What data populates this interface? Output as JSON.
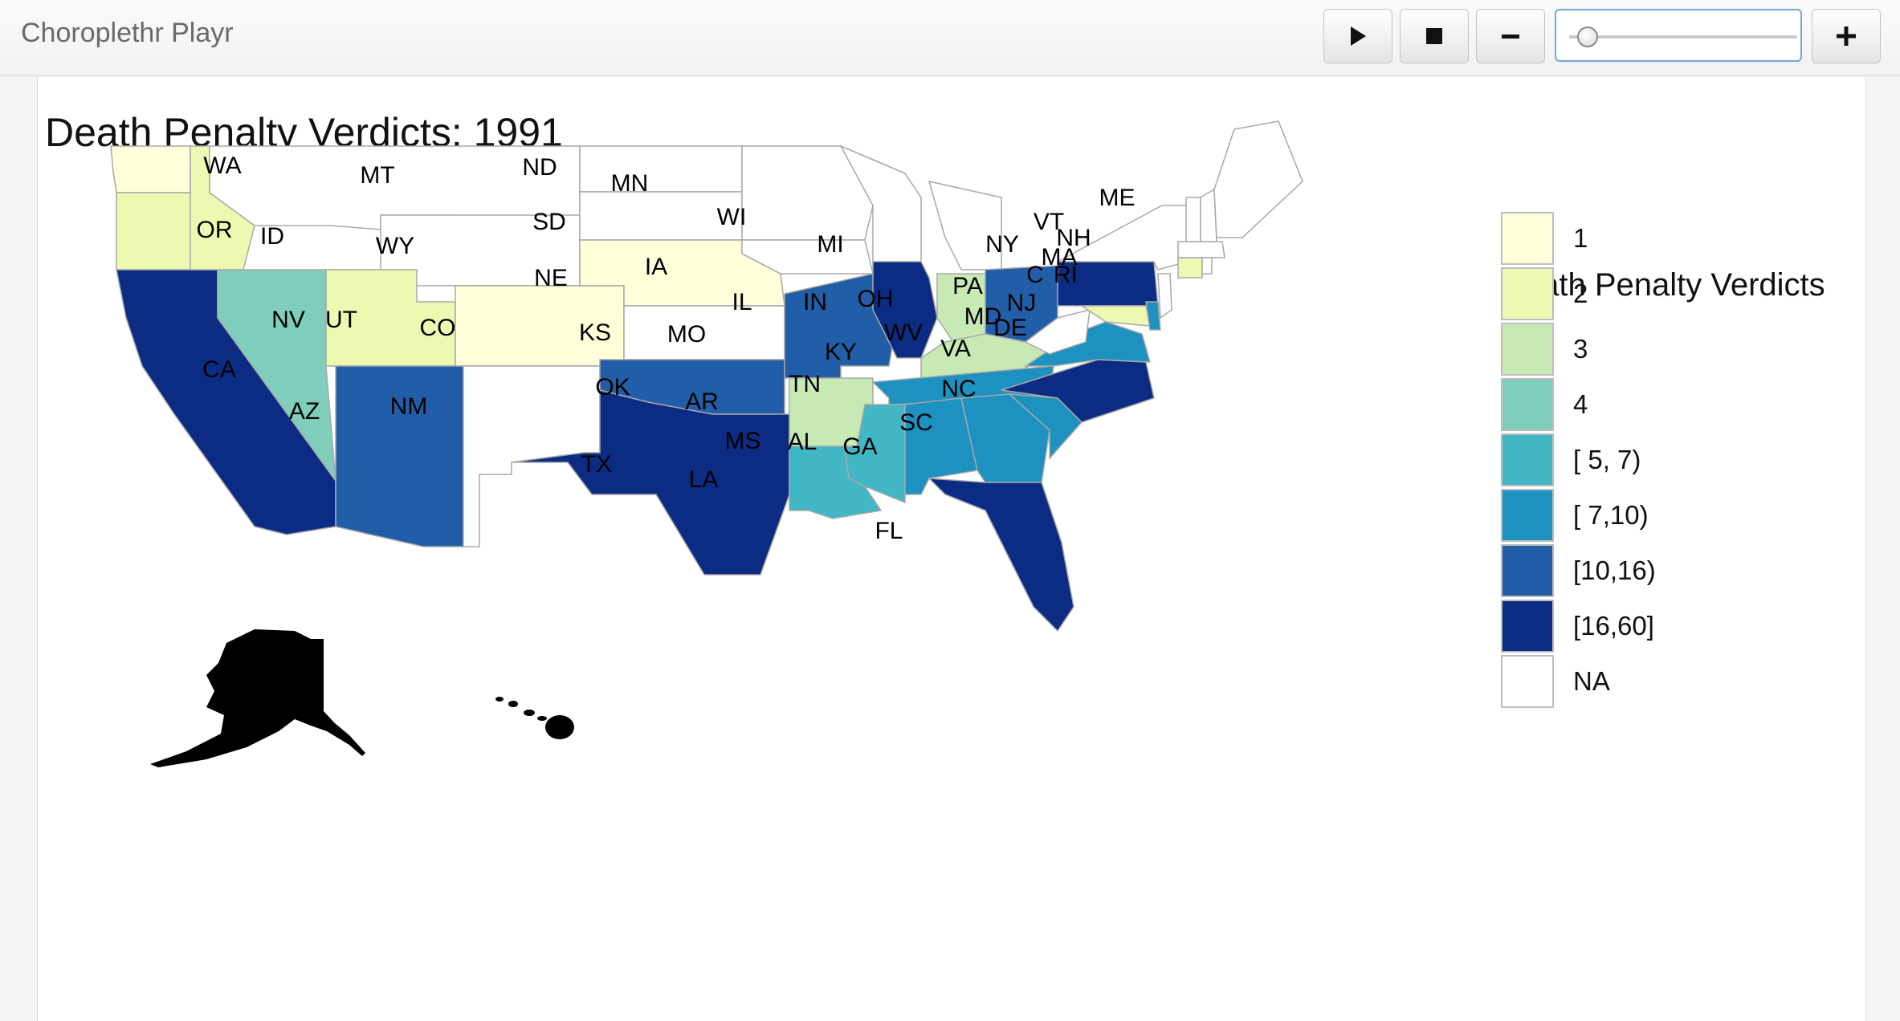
{
  "app": {
    "title": "Choroplethr Playr"
  },
  "controls": {
    "play_icon": "play-icon",
    "stop_icon": "stop-icon",
    "minus_icon": "minus-icon",
    "plus_icon": "plus-icon",
    "slider_value_fraction": 0.08
  },
  "map": {
    "title": "Death Penalty Verdicts: 1991",
    "legend": {
      "title": "Death Penalty Verdicts",
      "items": [
        {
          "label": "1",
          "color": "#ffffd9"
        },
        {
          "label": "2",
          "color": "#edf8b1"
        },
        {
          "label": "3",
          "color": "#c7e9b4"
        },
        {
          "label": "4",
          "color": "#7fcdbb"
        },
        {
          "label": "[ 5, 7)",
          "color": "#41b6c4"
        },
        {
          "label": "[ 7,10)",
          "color": "#1d91c0"
        },
        {
          "label": "[10,16)",
          "color": "#225ea8"
        },
        {
          "label": "[16,60]",
          "color": "#0c2c84"
        },
        {
          "label": "NA",
          "color": "#ffffff"
        }
      ]
    },
    "states": [
      {
        "abbr": "WA",
        "bin": "1"
      },
      {
        "abbr": "OR",
        "bin": "2"
      },
      {
        "abbr": "CA",
        "bin": "[16,60]"
      },
      {
        "abbr": "ID",
        "bin": "2"
      },
      {
        "abbr": "NV",
        "bin": "4"
      },
      {
        "abbr": "MT",
        "bin": "NA"
      },
      {
        "abbr": "WY",
        "bin": "NA"
      },
      {
        "abbr": "UT",
        "bin": "2"
      },
      {
        "abbr": "CO",
        "bin": "1"
      },
      {
        "abbr": "AZ",
        "bin": "[10,16)"
      },
      {
        "abbr": "NM",
        "bin": "NA"
      },
      {
        "abbr": "ND",
        "bin": "NA"
      },
      {
        "abbr": "SD",
        "bin": "NA"
      },
      {
        "abbr": "NE",
        "bin": "1"
      },
      {
        "abbr": "KS",
        "bin": "NA"
      },
      {
        "abbr": "OK",
        "bin": "[10,16)"
      },
      {
        "abbr": "TX",
        "bin": "[16,60]"
      },
      {
        "abbr": "MN",
        "bin": "NA"
      },
      {
        "abbr": "IA",
        "bin": "NA"
      },
      {
        "abbr": "MO",
        "bin": "[10,16)"
      },
      {
        "abbr": "AR",
        "bin": "3"
      },
      {
        "abbr": "LA",
        "bin": "[ 5, 7)"
      },
      {
        "abbr": "WI",
        "bin": "NA"
      },
      {
        "abbr": "IL",
        "bin": "[16,60]"
      },
      {
        "abbr": "MI",
        "bin": "NA"
      },
      {
        "abbr": "IN",
        "bin": "3"
      },
      {
        "abbr": "OH",
        "bin": "[10,16)"
      },
      {
        "abbr": "KY",
        "bin": "3"
      },
      {
        "abbr": "TN",
        "bin": "[ 7,10)"
      },
      {
        "abbr": "MS",
        "bin": "[ 5, 7)"
      },
      {
        "abbr": "AL",
        "bin": "[ 7,10)"
      },
      {
        "abbr": "GA",
        "bin": "[ 7,10)"
      },
      {
        "abbr": "FL",
        "bin": "[16,60]"
      },
      {
        "abbr": "SC",
        "bin": "[ 7,10)"
      },
      {
        "abbr": "NC",
        "bin": "[16,60]"
      },
      {
        "abbr": "VA",
        "bin": "[ 7,10)"
      },
      {
        "abbr": "WV",
        "bin": "NA"
      },
      {
        "abbr": "PA",
        "bin": "[16,60]"
      },
      {
        "abbr": "NY",
        "bin": "NA"
      },
      {
        "abbr": "MD",
        "bin": "2"
      },
      {
        "abbr": "DE",
        "bin": "[ 7,10)"
      },
      {
        "abbr": "NJ",
        "bin": "NA"
      },
      {
        "abbr": "C",
        "bin": "2"
      },
      {
        "abbr": "RI",
        "bin": "NA"
      },
      {
        "abbr": "MA",
        "bin": "NA"
      },
      {
        "abbr": "VT",
        "bin": "NA"
      },
      {
        "abbr": "NH",
        "bin": "NA"
      },
      {
        "abbr": "ME",
        "bin": "NA"
      }
    ]
  }
}
